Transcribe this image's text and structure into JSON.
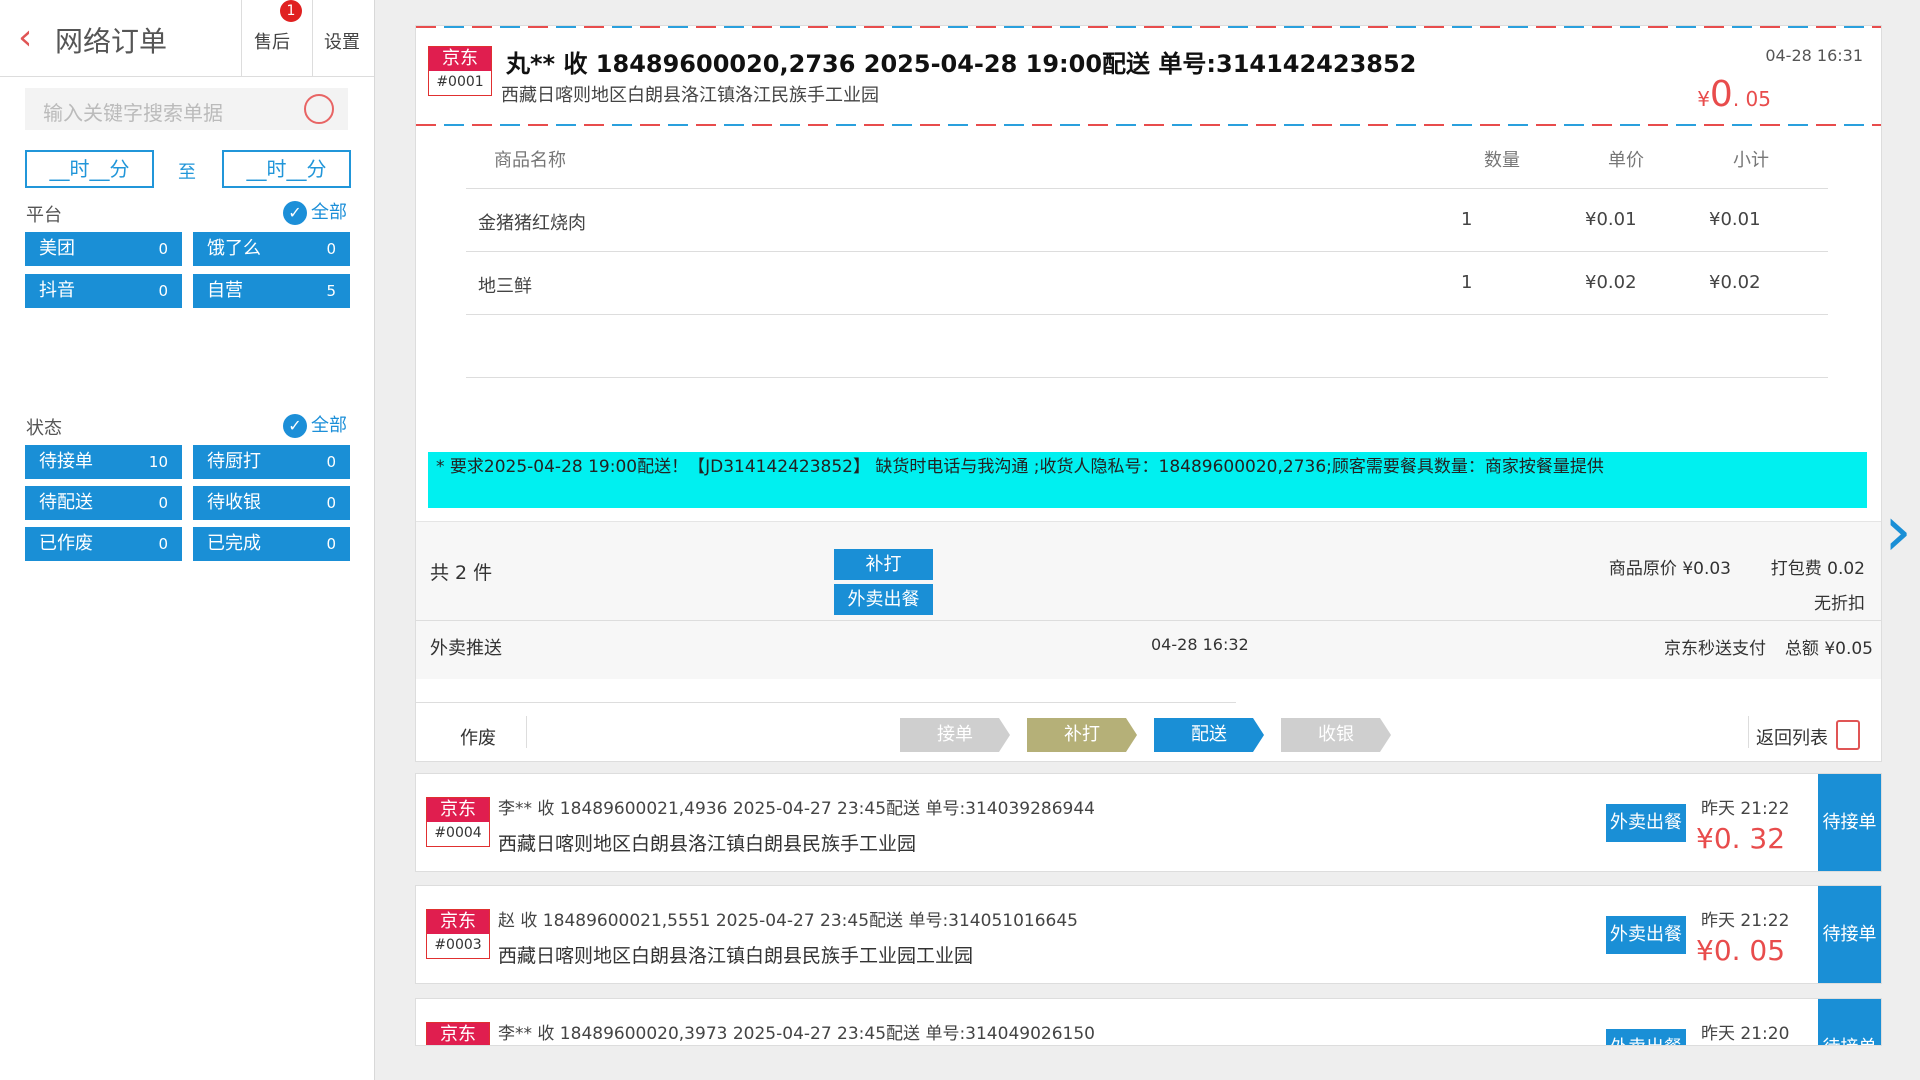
{
  "sidebar": {
    "title": "网络订单",
    "aftersale": "售后",
    "aftersale_badge": "1",
    "settings": "设置",
    "search_placeholder": "输入关键字搜索单据",
    "time_from": "__时__分",
    "to": "至",
    "time_to": "__时__分",
    "platform_label": "平台",
    "all_label": "全部",
    "platforms": [
      {
        "name": "美团",
        "count": "0"
      },
      {
        "name": "饿了么",
        "count": "0"
      },
      {
        "name": "抖音",
        "count": "0"
      },
      {
        "name": "自营",
        "count": "5"
      }
    ],
    "status_label": "状态",
    "statuses": [
      {
        "name": "待接单",
        "count": "10"
      },
      {
        "name": "待厨打",
        "count": "0"
      },
      {
        "name": "待配送",
        "count": "0"
      },
      {
        "name": "待收银",
        "count": "0"
      },
      {
        "name": "已作废",
        "count": "0"
      },
      {
        "name": "已完成",
        "count": "0"
      }
    ]
  },
  "order": {
    "platform": "京东",
    "seq": "#0001",
    "header": "丸** 收 18489600020,2736 2025-04-28 19:00配送 单号:314142423852",
    "address": "西藏日喀则地区白朗县洛江镇洛江民族手工业园",
    "time": "04-28 16:31",
    "amount_symbol": "¥",
    "amount_int": "0",
    "amount_dec": ". 05",
    "columns": {
      "name": "商品名称",
      "qty": "数量",
      "price": "单价",
      "subtotal": "小计"
    },
    "items": [
      {
        "name": "金猪猪红烧肉",
        "qty": "1",
        "price": "¥0.01",
        "subtotal": "¥0.01"
      },
      {
        "name": "地三鲜",
        "qty": "1",
        "price": "¥0.02",
        "subtotal": "¥0.02"
      }
    ],
    "note": "* 要求2025-04-28 19:00配送！【JD314142423852】 缺货时电话与我沟通 ;收货人隐私号：18489600020,2736;顾客需要餐具数量：商家按餐量提供",
    "total_count": "共 2 件",
    "reprint": "补打",
    "takeout_out": "外卖出餐",
    "original_price": "商品原价 ¥0.03",
    "package_fee": "打包费 0.02",
    "no_discount": "无折扣",
    "delivery": "外卖推送",
    "delivery_time": "04-28 16:32",
    "pay_method": "京东秒送支付",
    "total": "总额 ¥0.05",
    "void": "作废",
    "steps": [
      "接单",
      "补打",
      "配送",
      "收银"
    ],
    "back_to_list": "返回列表"
  },
  "cards": [
    {
      "platform": "京东",
      "seq": "#0004",
      "header": "李** 收 18489600021,4936 2025-04-27 23:45配送 单号:314039286944",
      "address": "西藏日喀则地区白朗县洛江镇白朗县民族手工业园",
      "btn": "外卖出餐",
      "time": "昨天 21:22",
      "amount": "¥0. 32",
      "status": "待接单"
    },
    {
      "platform": "京东",
      "seq": "#0003",
      "header": "赵 收 18489600021,5551 2025-04-27 23:45配送 单号:314051016645",
      "address": "西藏日喀则地区白朗县洛江镇白朗县民族手工业园工业园",
      "btn": "外卖出餐",
      "time": "昨天 21:22",
      "amount": "¥0. 05",
      "status": "待接单"
    },
    {
      "platform": "京东",
      "seq": "",
      "header": "李** 收 18489600020,3973 2025-04-27 23:45配送 单号:314049026150",
      "address": "",
      "btn": "外卖出餐",
      "time": "昨天 21:20",
      "amount": "",
      "status": "待接单"
    }
  ]
}
